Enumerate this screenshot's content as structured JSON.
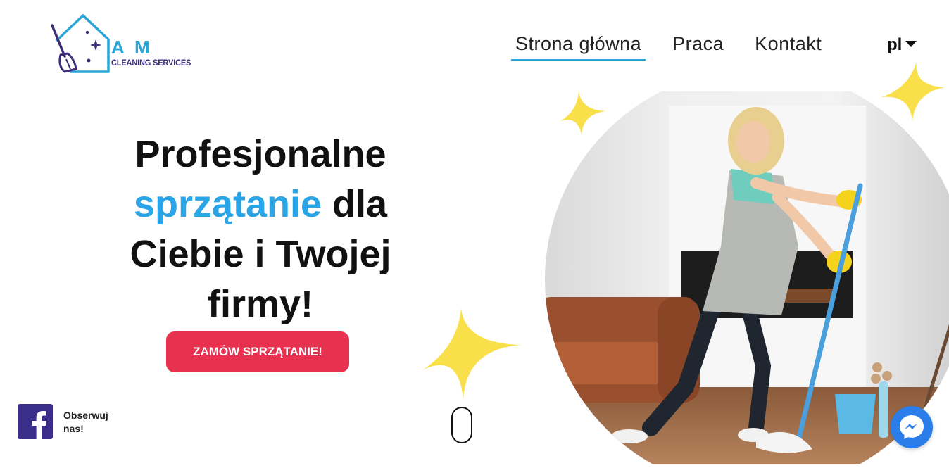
{
  "logo": {
    "brand_initials": "A M",
    "brand_sub": "CLEANING SERVICES",
    "icon": "house-broom-logo-icon",
    "colors": {
      "blue": "#2aa5d6",
      "purple": "#3d2c7a"
    }
  },
  "nav": {
    "items": [
      {
        "label": "Strona główna",
        "active": true
      },
      {
        "label": "Praca",
        "active": false
      },
      {
        "label": "Kontakt",
        "active": false
      }
    ],
    "language": {
      "selected": "pl",
      "icon": "caret-down-icon"
    }
  },
  "hero": {
    "line1": "Profesjonalne",
    "accent_word": "sprzątanie",
    "line2_rest": " dla",
    "line3": "Ciebie i Twojej",
    "line4": "firmy!",
    "cta_label": "ZAMÓW SPRZĄTANIE!",
    "accent_color": "#2aa5e8",
    "cta_color": "#e8304f"
  },
  "social": {
    "facebook_icon": "facebook-icon",
    "follow_text": "Obserwuj nas!"
  },
  "scroll_indicator": {
    "icon": "mouse-scroll-icon"
  },
  "messenger": {
    "icon": "messenger-icon",
    "color": "#2b7de9"
  },
  "decor": {
    "sparkle_color": "#f9e04b"
  }
}
